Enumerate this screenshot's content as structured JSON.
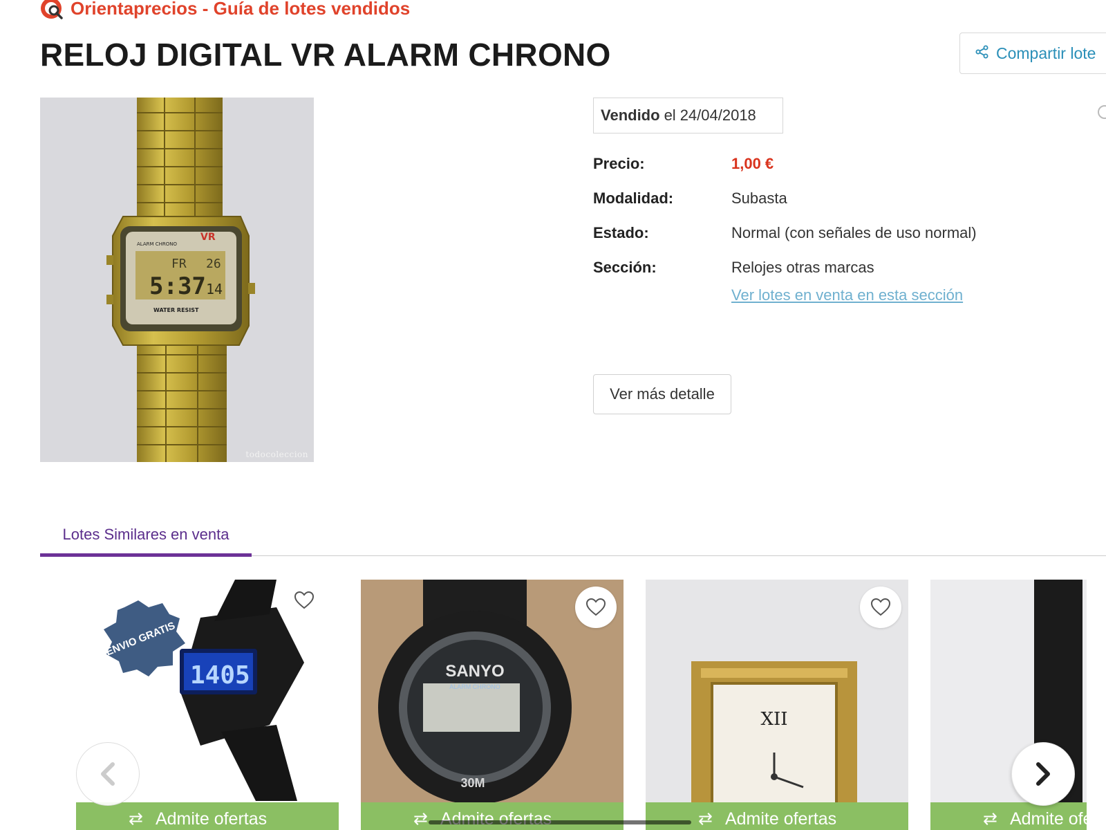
{
  "header": {
    "site_title": "Orientaprecios - Guía de lotes vendidos",
    "brand_color": "#e0432b"
  },
  "product": {
    "title": "RELOJ DIGITAL VR ALARM CHRONO",
    "share_label": "Compartir lote",
    "image_watermark": "todocoleccion",
    "sold": {
      "label": "Vendido",
      "connector": "el",
      "date": "24/04/2018"
    },
    "details": [
      {
        "label": "Precio:",
        "value": "1,00 €"
      },
      {
        "label": "Modalidad:",
        "value": "Subasta"
      },
      {
        "label": "Estado:",
        "value": "Normal (con señales de uso normal)"
      },
      {
        "label": "Sección:",
        "value": "Relojes otras marcas"
      }
    ],
    "section_link": "Ver lotes en venta en esta sección",
    "more_button": "Ver más detalle",
    "price_color": "#d9331d"
  },
  "similar": {
    "tab_label": "Lotes Similares en venta",
    "tab_color": "#6c3297",
    "items": [
      {
        "badge": "ENVIO GRATIS",
        "offer_label": "Admite ofertas",
        "lcd_text": "1405"
      },
      {
        "brand": "SANYO",
        "subtitle": "ALARM CHRONO",
        "bottom_text": "30M",
        "offer_label": "Admite ofertas"
      },
      {
        "numeral": "XII",
        "offer_label": "Admite ofertas"
      },
      {
        "offer_label": "Admite ofertas"
      }
    ],
    "offer_bar_color": "#8bbf63"
  },
  "watch_face": {
    "brand_line": "ALARM CHRONO",
    "mark": "VR",
    "day": "FR",
    "date": "26",
    "time": "5:37",
    "seconds": "14",
    "footer": "WATER RESIST"
  }
}
